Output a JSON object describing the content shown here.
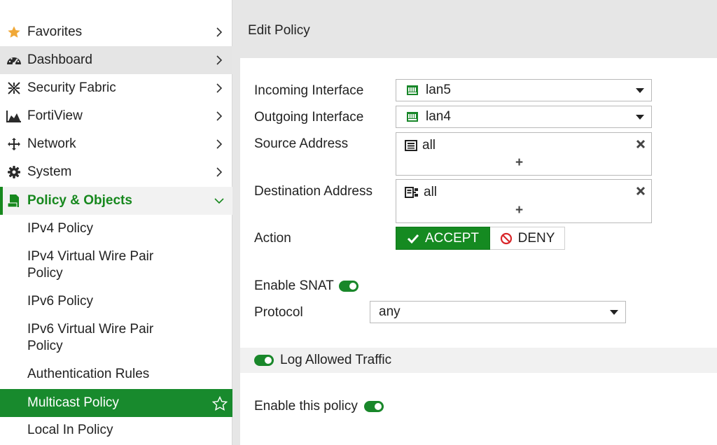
{
  "sidebar": {
    "items": [
      {
        "label": "Favorites",
        "icon": "star-icon"
      },
      {
        "label": "Dashboard",
        "icon": "dashboard-icon"
      },
      {
        "label": "Security Fabric",
        "icon": "security-fabric-icon"
      },
      {
        "label": "FortiView",
        "icon": "chart-icon"
      },
      {
        "label": "Network",
        "icon": "network-icon"
      },
      {
        "label": "System",
        "icon": "gear-icon"
      },
      {
        "label": "Policy & Objects",
        "icon": "policy-icon"
      }
    ],
    "sub_items": [
      {
        "label": "IPv4 Policy"
      },
      {
        "label": "IPv4 Virtual Wire Pair Policy"
      },
      {
        "label": "IPv6 Policy"
      },
      {
        "label": "IPv6 Virtual Wire Pair Policy"
      },
      {
        "label": "Authentication Rules"
      },
      {
        "label": "Multicast Policy"
      },
      {
        "label": "Local In Policy"
      }
    ]
  },
  "header": {
    "title": "Edit Policy"
  },
  "form": {
    "incoming_interface": {
      "label": "Incoming Interface",
      "value": "lan5"
    },
    "outgoing_interface": {
      "label": "Outgoing Interface",
      "value": "lan4"
    },
    "source_address": {
      "label": "Source Address",
      "value": "all",
      "add": "+"
    },
    "destination_address": {
      "label": "Destination Address",
      "value": "all",
      "add": "+"
    },
    "action": {
      "label": "Action",
      "accept": "ACCEPT",
      "deny": "DENY"
    },
    "enable_snat": {
      "label": "Enable SNAT",
      "enabled": true
    },
    "protocol": {
      "label": "Protocol",
      "value": "any"
    },
    "log_allowed_traffic": {
      "label": "Log Allowed Traffic",
      "enabled": true
    },
    "enable_policy": {
      "label": "Enable this policy",
      "enabled": true
    }
  },
  "colors": {
    "accent": "#17881e",
    "active_bg": "#188a2d",
    "sidebar_bg": "#ffffff"
  }
}
